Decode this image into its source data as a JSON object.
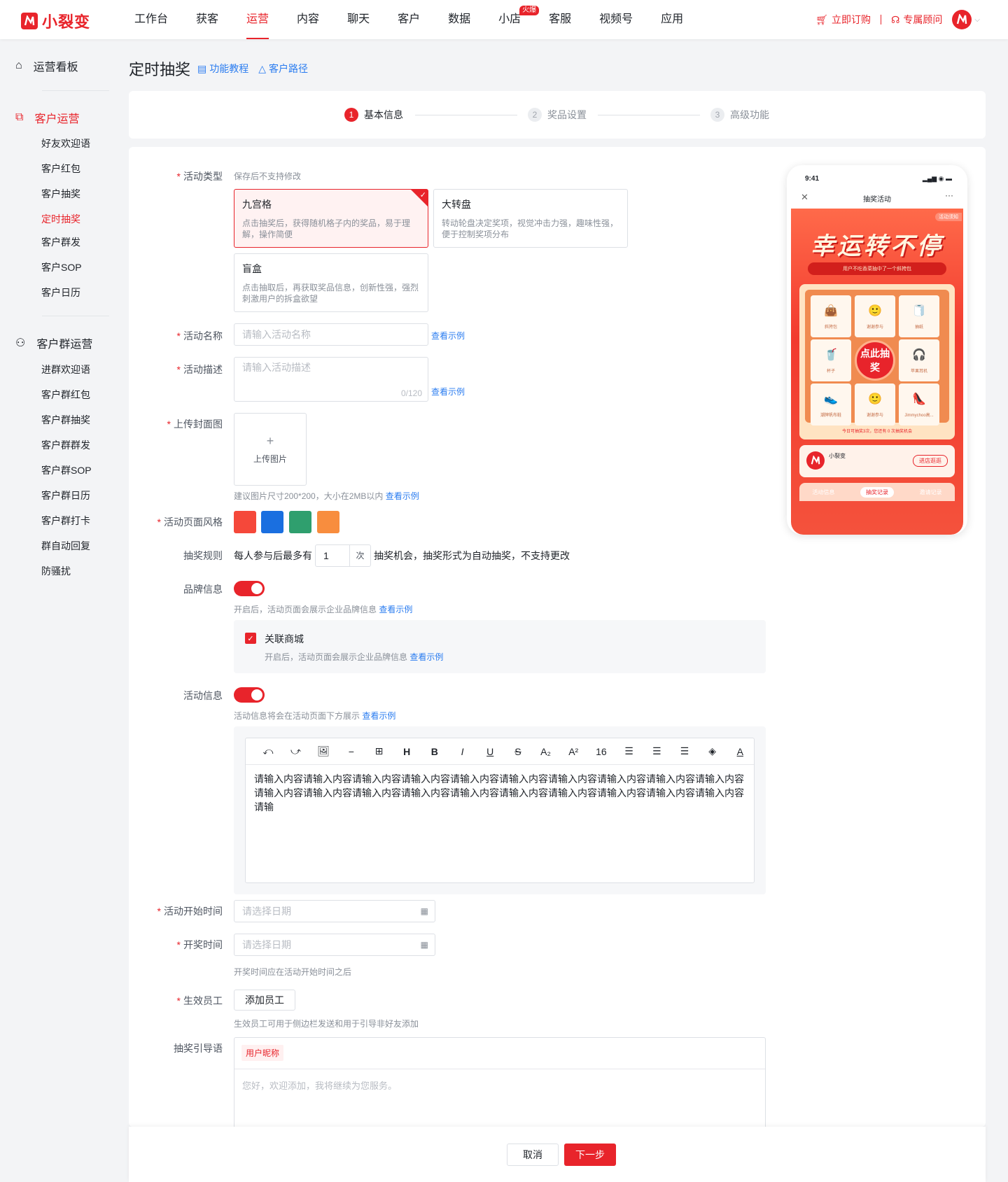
{
  "brand": {
    "name": "小裂变"
  },
  "nav": [
    "工作台",
    "获客",
    "运营",
    "内容",
    "聊天",
    "客户",
    "数据",
    "小店",
    "客服",
    "视频号",
    "应用"
  ],
  "nav_hot": "火爆",
  "top_actions": {
    "order": "立即订购",
    "advisor": "专属顾问"
  },
  "sidebar": {
    "dashboard": "运营看板",
    "customer_ops": {
      "title": "客户运营",
      "items": [
        "好友欢迎语",
        "客户红包",
        "客户抽奖",
        "定时抽奖",
        "客户群发",
        "客户SOP",
        "客户日历"
      ]
    },
    "group_ops": {
      "title": "客户群运营",
      "items": [
        "进群欢迎语",
        "客户群红包",
        "客户群抽奖",
        "客户群群发",
        "客户群SOP",
        "客户群日历",
        "客户群打卡",
        "群自动回复",
        "防骚扰"
      ]
    }
  },
  "page": {
    "title": "定时抽奖",
    "tutorial": "功能教程",
    "path": "客户路径"
  },
  "steps": [
    {
      "num": "1",
      "label": "基本信息"
    },
    {
      "num": "2",
      "label": "奖品设置"
    },
    {
      "num": "3",
      "label": "高级功能"
    }
  ],
  "form": {
    "type": {
      "label": "活动类型",
      "hint": "保存后不支持修改",
      "options": [
        {
          "title": "九宫格",
          "desc": "点击抽奖后，获得随机格子内的奖品，易于理解，操作简便"
        },
        {
          "title": "大转盘",
          "desc": "转动轮盘决定奖项，视觉冲击力强，趣味性强，便于控制奖项分布"
        },
        {
          "title": "盲盒",
          "desc": "点击抽取后，再获取奖品信息，创新性强，强烈刺激用户的拆盒欲望"
        }
      ]
    },
    "name": {
      "label": "活动名称",
      "placeholder": "请输入活动名称"
    },
    "desc": {
      "label": "活动描述",
      "placeholder": "请输入活动描述",
      "counter": "0/120"
    },
    "example": "查看示例",
    "cover": {
      "label": "上传封面图",
      "button": "上传图片",
      "hint": "建议图片尺寸200*200，大小在2MB以内"
    },
    "style": {
      "label": "活动页面风格",
      "colors": [
        "#f5483a",
        "#1a6fe0",
        "#2f9f6e",
        "#f88d3e"
      ]
    },
    "rule": {
      "label": "抽奖规则",
      "prefix": "每人参与后最多有",
      "value": "1",
      "unit": "次",
      "suffix": "抽奖机会，抽奖形式为自动抽奖，不支持更改"
    },
    "brand_info": {
      "label": "品牌信息",
      "hint": "开启后，活动页面会展示企业品牌信息",
      "enabled": true,
      "mall": {
        "title": "关联商城",
        "hint": "开启后，活动页面会展示企业品牌信息",
        "checked": true
      }
    },
    "activity_info": {
      "label": "活动信息",
      "hint": "活动信息将会在活动页面下方展示",
      "enabled": true
    },
    "editor": {
      "toolbar": [
        "⤺",
        "⤻",
        "🖼",
        "−",
        "⊞",
        "H",
        "B",
        "I",
        "U",
        "S",
        "A₂",
        "A²",
        "16",
        "☰",
        "☰",
        "☰",
        "◈",
        "A"
      ],
      "content": "请输入内容请输入内容请输入内容请输入内容请输入内容请输入内容请输入内容请输入内容请输入内容请输入内容请输入内容请输入内容请输入内容请输入内容请输入内容请输入内容请输入内容请输入内容请输入内容请输入内容请输"
    },
    "start_time": {
      "label": "活动开始时间",
      "placeholder": "请选择日期"
    },
    "draw_time": {
      "label": "开奖时间",
      "placeholder": "请选择日期",
      "hint": "开奖时间应在活动开始时间之后"
    },
    "staff": {
      "label": "生效员工",
      "button": "添加员工",
      "hint": "生效员工可用于侧边栏发送和用于引导非好友添加"
    },
    "guide": {
      "label": "抽奖引导语",
      "tag": "用户昵称",
      "placeholder": "您好，欢迎添加，我将继续为您服务。"
    }
  },
  "preview": {
    "time": "9:41",
    "head": "抽奖活动",
    "rule": "活动须知",
    "title": "幸运转不停",
    "ticker": "用户不吃香菜抽中了一个斜挎包",
    "cells": [
      {
        "icon": "👜",
        "name": "斜挎包"
      },
      {
        "icon": "🙂",
        "name": "谢谢参与"
      },
      {
        "icon": "🧻",
        "name": "抽纸"
      },
      {
        "icon": "🥤",
        "name": "杯子"
      },
      {
        "icon": "🎧",
        "name": "苹果耳机"
      },
      {
        "icon": "👟",
        "name": "潮牌帆布鞋"
      },
      {
        "icon": "🙂",
        "name": "谢谢参与"
      },
      {
        "icon": "👠",
        "name": "Jimmychoo高..."
      }
    ],
    "center": "点此抽奖",
    "counter": "今日可抽奖3次，您还有 0 次抽奖机会",
    "shop": "小裂变",
    "shop_btn": "进店逛逛",
    "tabs": [
      "活动信息",
      "抽奖记录",
      "邀请记录"
    ]
  },
  "footer": {
    "cancel": "取消",
    "next": "下一步"
  }
}
